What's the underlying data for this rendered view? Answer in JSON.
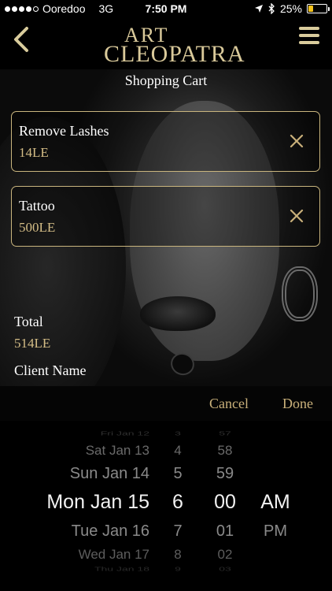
{
  "status_bar": {
    "carrier": "Ooredoo",
    "network": "3G",
    "time": "7:50 PM",
    "battery": "25%",
    "battery_level": 0.25,
    "battery_color": "#f2c21b"
  },
  "header": {
    "logo_line1": "ART",
    "logo_line2": "CLEOPATRA"
  },
  "page_title": "Shopping Cart",
  "cart_items": [
    {
      "name": "Remove Lashes",
      "price": "14LE"
    },
    {
      "name": "Tattoo",
      "price": "500LE"
    }
  ],
  "total": {
    "label": "Total",
    "value": "514LE"
  },
  "client_name_label": "Client Name",
  "picker_toolbar": {
    "cancel": "Cancel",
    "done": "Done"
  },
  "date_picker": {
    "dates": [
      "Fri Jan 12",
      "Sat Jan 13",
      "Sun Jan 14",
      "Mon Jan 15",
      "Tue Jan 16",
      "Wed Jan 17",
      "Thu Jan 18"
    ],
    "hours": [
      "3",
      "4",
      "5",
      "6",
      "7",
      "8",
      "9"
    ],
    "minutes": [
      "57",
      "58",
      "59",
      "00",
      "01",
      "02",
      "03"
    ],
    "ampm": [
      "",
      "",
      "",
      "AM",
      "PM",
      "",
      ""
    ],
    "selected": {
      "date": "Mon Jan 15",
      "hour": "6",
      "minute": "00",
      "ampm": "AM"
    }
  },
  "colors": {
    "accent_gold": "#d4bd86",
    "border_gold": "#c9b57e",
    "background": "#000000"
  }
}
